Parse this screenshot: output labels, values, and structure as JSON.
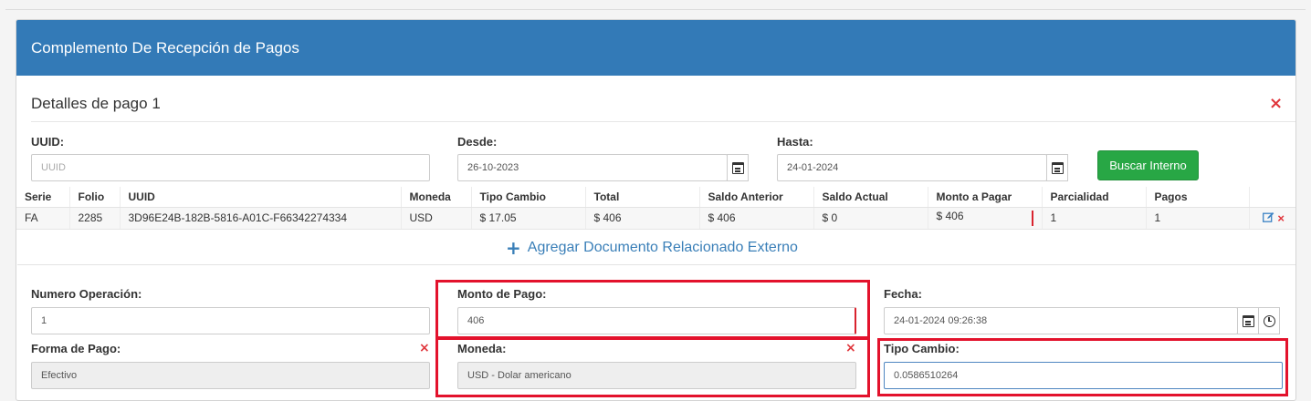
{
  "panel": {
    "title": "Complemento De Recepción de Pagos"
  },
  "detail": {
    "title": "Detalles de pago 1",
    "close_icon": "×"
  },
  "search": {
    "uuid_label": "UUID:",
    "uuid_placeholder": "UUID",
    "desde_label": "Desde:",
    "desde_value": "26-10-2023",
    "hasta_label": "Hasta:",
    "hasta_value": "24-01-2024",
    "buscar_label": "Buscar Interno"
  },
  "documents": {
    "headers": [
      "Serie",
      "Folio",
      "UUID",
      "Moneda",
      "Tipo Cambio",
      "Total",
      "Saldo Anterior",
      "Saldo Actual",
      "Monto a Pagar",
      "Parcialidad",
      "Pagos",
      ""
    ],
    "rows": [
      [
        "FA",
        "2285",
        "3D96E24B-182B-5816-A01C-F66342274334",
        "USD",
        "$ 17.05",
        "$ 406",
        "$ 406",
        "$ 0",
        "$ 406",
        "1",
        "1"
      ]
    ],
    "edit_icon": "edit-icon",
    "delete_icon": "×",
    "add_label": "Agregar Documento Relacionado Externo",
    "add_icon": "+"
  },
  "payment": {
    "numero_label": "Numero Operación:",
    "numero_value": "1",
    "monto_label": "Monto de Pago:",
    "monto_value": "406",
    "fecha_label": "Fecha:",
    "fecha_value": "24-01-2024 09:26:38",
    "forma_label": "Forma de Pago:",
    "forma_value": "Efectivo",
    "moneda_label": "Moneda:",
    "moneda_value": "USD - Dolar americano",
    "tipo_label": "Tipo Cambio:",
    "tipo_value": "0.0586510264",
    "clear_icon": "×"
  },
  "colors": {
    "header": "#337ab7",
    "button": "#28a745",
    "highlight": "#e3122c",
    "danger": "#e0353b",
    "link": "#3a7fb8"
  }
}
